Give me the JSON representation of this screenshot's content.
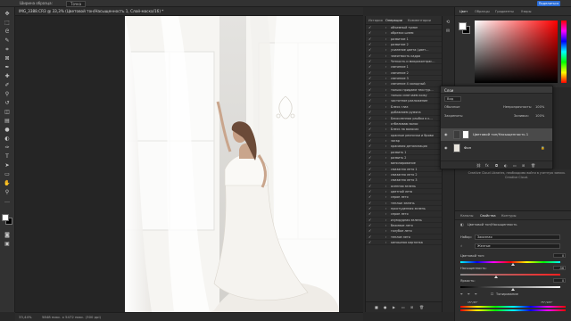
{
  "options_bar": {
    "label": "Ширина образца:",
    "sample": "Точка"
  },
  "share_button": "Поделиться",
  "document_tab": "IMG_3388.CR3 @ 33,3% (Цветовой тон/Насыщенность 1, Слой-маска/16) *",
  "status_bar": {
    "zoom": "33,44%",
    "dimensions": "5848 пикс. x 5472 пикс. (300 ppi)"
  },
  "history_panel": {
    "tabs": [
      "История",
      "Операции",
      "Комментарии"
    ],
    "active_tab": "Операции",
    "items": [
      "объемный туман",
      "обрезки шлем",
      "развитие 1",
      "развитие 2",
      "усиление цвета (цвет…",
      "чмеитмость кадра",
      "Четкость и микроконтрас…",
      "свечение 1",
      "свечение 2",
      "свечение 3",
      "свечение 4 холодный",
      "только придаем текстур…",
      "только смягчаем кожу",
      "частотное разложение",
      "Блеск глаз",
      "добавляем румяна",
      "Бесосленная улыбка в к…",
      "отбеливаю волос",
      "Блеск на волосах",
      "красные реснички и брови",
      "загар",
      "красивая детализация",
      "развить 1",
      "развить 2",
      "винилирование",
      "смазанно лето 1",
      "смазанно лето 2",
      "смазанно лето 3",
      "осенняя зелень",
      "цветной лето",
      "серое лето",
      "теплые зелень",
      "пристуденная зелень",
      "серое лето",
      "изумрудная зелень",
      "бежевое лето",
      "голубое лето",
      "теплое лето",
      "киношная картинка"
    ]
  },
  "layers_panel": {
    "title": "Слои",
    "kind": "Вид",
    "blend": "Обычные",
    "opacity_label": "Непрозрачность:",
    "opacity": "100%",
    "lock_label": "Закрепить:",
    "fill_label": "Заливка:",
    "fill": "100%",
    "layers": [
      {
        "name": "Цветовой тон/Насыщенность 1"
      },
      {
        "name": "Фон"
      }
    ]
  },
  "color_panel": {
    "tabs": [
      "Цвет",
      "Образцы",
      "Градиенты",
      "Узоры"
    ],
    "active_tab": "Цвет"
  },
  "libraries_text": "Creative Cloud Libraries, необходимо войти в учетную запись Creative Cloud.",
  "properties_panel": {
    "tabs": [
      "Каналы",
      "Свойства",
      "Контуры"
    ],
    "active_tab": "Свойства",
    "adjustment_name": "Цветовой тон/Насыщенность",
    "preset_label": "Набор:",
    "preset": "Заказная",
    "channel": "Желтые",
    "hue_label": "Цветовой тон:",
    "hue": "0",
    "saturation_label": "Насыщенность:",
    "saturation": "-56",
    "lightness_label": "Яркость:",
    "lightness": "0",
    "colorize_label": "Тонирование",
    "range_left": "15°/45°",
    "range_right": "75°/105°"
  }
}
